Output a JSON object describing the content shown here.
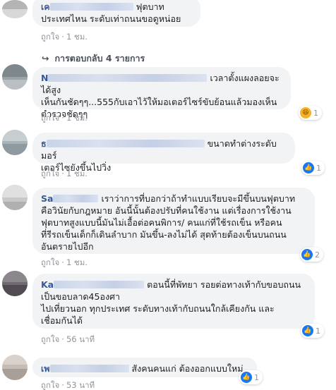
{
  "comments": [
    {
      "name": "เค",
      "text_lines": [
        "ฟุตบาท",
        "ประเทศไหน ระดับเท่าถนนขอดูหน่อย"
      ],
      "like_label": "ถูกใจ",
      "time": "1 ชม."
    },
    {
      "name": "N",
      "text_lines": [
        "เวลาตั้งแผงลอยจะได้สูง",
        "เห็นกันชัดๆๆ...555กับเอาไว้ให้มอเตอร์ไซร์ขับย้อนแล้วมองเห็น",
        "ตำรวจชัดๆๆ"
      ],
      "like_label": "ถูกใจ",
      "time": "1 ชม.",
      "reaction_count": "1"
    },
    {
      "name": "ธ",
      "text_lines": [
        "ขนาดทำต่างระดับมอร์",
        "เตอร์ไซยังขึ้นไปวิ่ง"
      ],
      "like_label": "ถูกใจ",
      "time": "1 ชม.",
      "reaction_count": "1"
    },
    {
      "name": "Sa",
      "text_lines": [
        "เราว่าการที่บอกว่าถ้าทำแบบเรียบจะมีขึ้นบนฟุตบาท",
        "คือวินัยกับกฎหมาย อันนี้นั้นต้องปรับที่คนใช้งาน แต่เรื่องการใช้งาน",
        "ฟุตบาทสูงแบบนี้มันไม่เอื้อต่อคนพิการ/ คนแก่ที่ใช้รถเข็น หรือคน",
        "ที่รีรถเข็นเด็กก็เดินลำบาก มันขึ้น-ลงไม่ได้ สุดท้ายต้องเข็นบนถนน",
        "อันตรายไปอีก"
      ],
      "like_label": "ถูกใจ",
      "time": "1 ชม.",
      "reaction_count": "2"
    },
    {
      "name": "Ka",
      "text_lines": [
        "ตอนนี้ที่พัทยา รอยต่อทางเท้ากับขอบถนน",
        "เป็นขอบลาด45องศา",
        "ไปเที่ยวนอก ทุกประเทศ ระดับทางเท้ากับถนนใกล้เคียงกัน และ",
        "เชื่อมกันได้"
      ],
      "like_label": "ถูกใจ",
      "time": "56 นาที",
      "reaction_count": "1"
    },
    {
      "name": "เพ",
      "text_lines": [
        "สังคนคนแก่ ต้องออกแบบใหม่"
      ],
      "like_label": "ถูกใจ",
      "time": "53 นาที",
      "reaction_count": "1"
    }
  ],
  "replies_label": "การตอบกลับ 4 รายการ",
  "colors": {
    "name": "#385898",
    "bubble": "#f2f3f5",
    "like_icon": "#1877f2"
  }
}
